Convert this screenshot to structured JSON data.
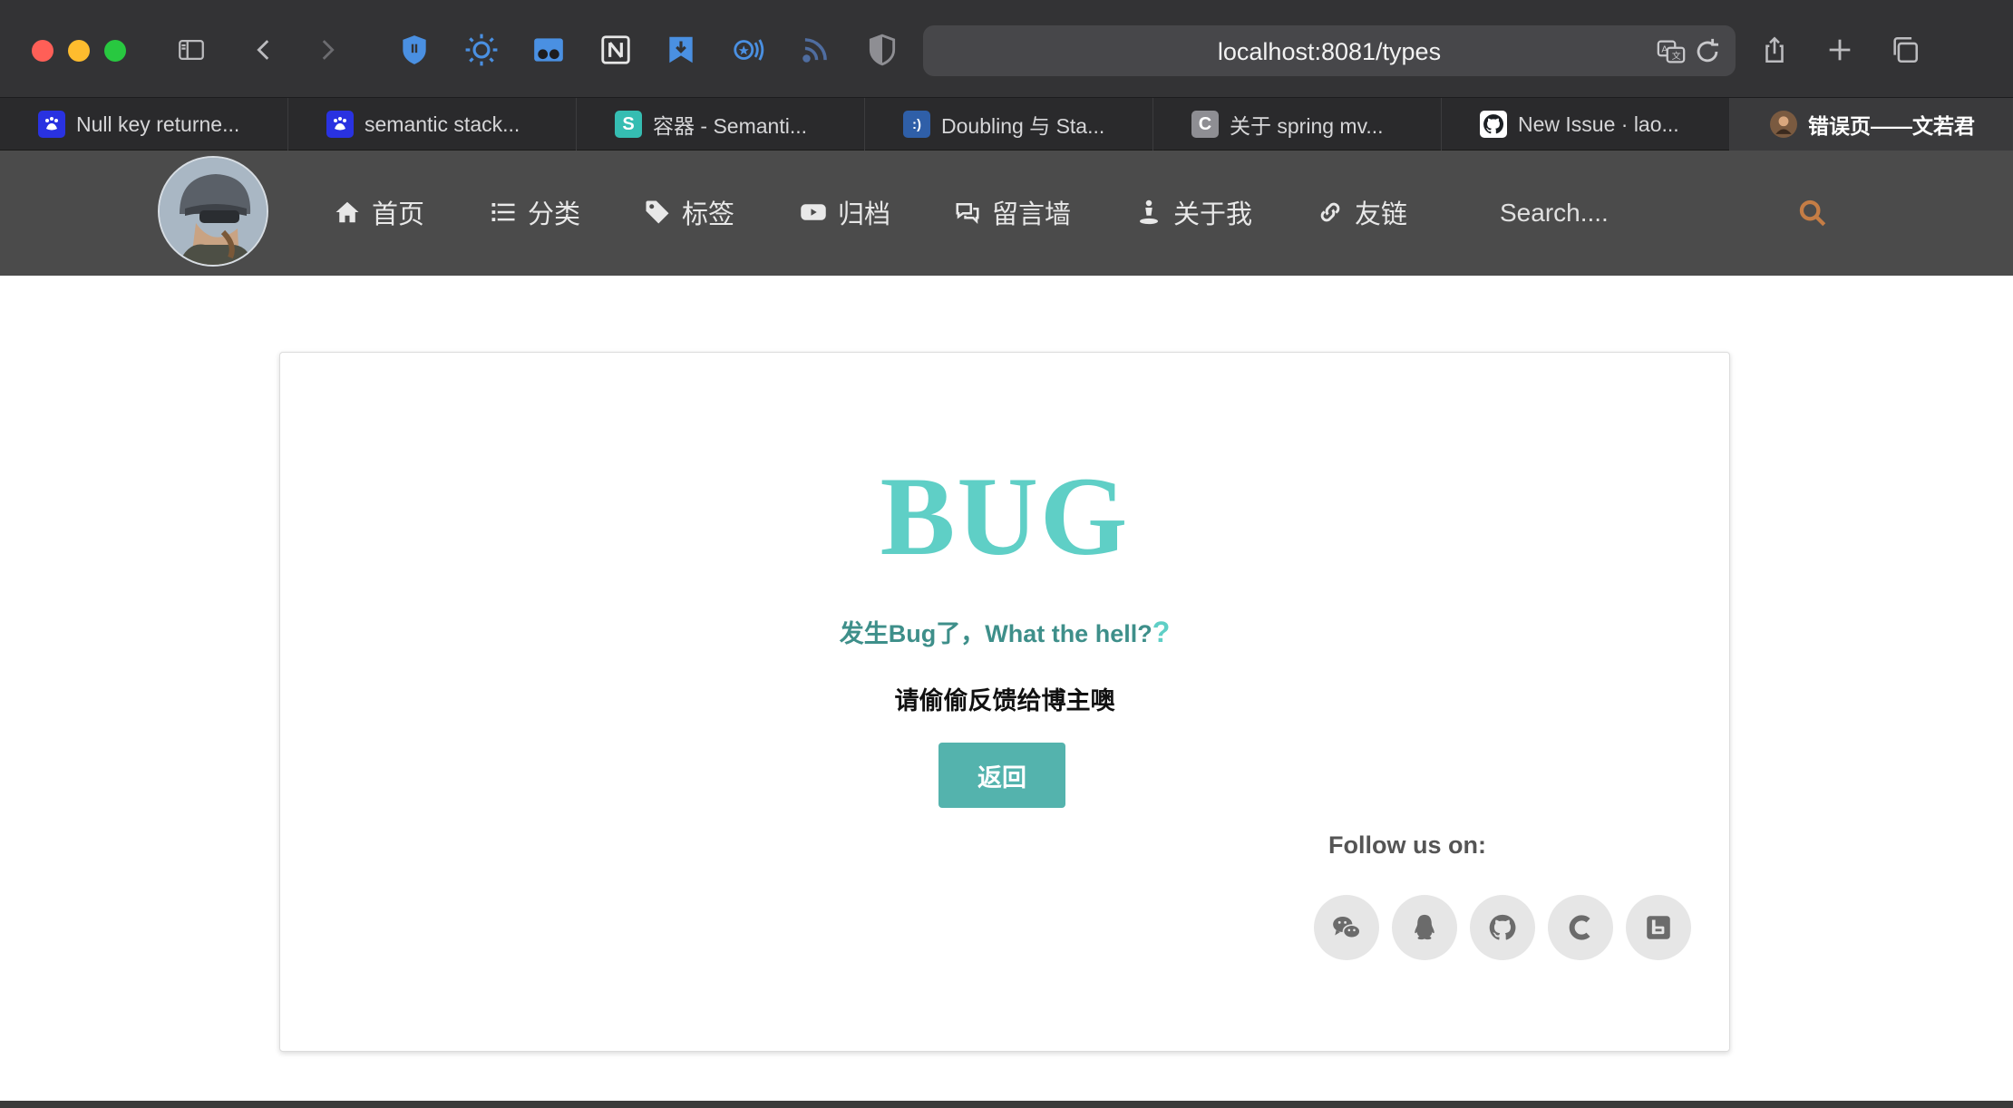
{
  "browser": {
    "url": "localhost:8081/types",
    "tabs": [
      {
        "label": "Null key returne...",
        "icon": "baidu-icon",
        "color": "#2932e1"
      },
      {
        "label": "semantic stack...",
        "icon": "baidu-icon",
        "color": "#2932e1"
      },
      {
        "label": "容器 - Semanti...",
        "icon": "semantic-s-icon",
        "color": "#35bdb2"
      },
      {
        "label": "Doubling 与 Sta...",
        "icon": "doubling-icon",
        "color": "#2f5fa8"
      },
      {
        "label": "关于 spring mv...",
        "icon": "c-icon",
        "color": "#8e8e93"
      },
      {
        "label": "New Issue · lao...",
        "icon": "github-icon",
        "color": "#ffffff"
      },
      {
        "label": "错误页——文若君",
        "icon": "avatar-icon",
        "color": "#7a5a40"
      }
    ]
  },
  "nav": {
    "items": [
      {
        "label": "首页",
        "icon": "home-icon"
      },
      {
        "label": "分类",
        "icon": "list-icon"
      },
      {
        "label": "标签",
        "icon": "tag-icon"
      },
      {
        "label": "归档",
        "icon": "youtube-icon"
      },
      {
        "label": "留言墙",
        "icon": "comments-icon"
      },
      {
        "label": "关于我",
        "icon": "user-icon"
      },
      {
        "label": "友链",
        "icon": "link-icon"
      }
    ],
    "search_placeholder": "Search...."
  },
  "error": {
    "title": "BUG",
    "subtitle": "发生Bug了，What the hell?",
    "subtitle_mark": "?",
    "description": "请偷偷反馈给博主噢",
    "back_label": "返回",
    "follow_label": "Follow us on:"
  },
  "social": [
    "wechat-icon",
    "qq-icon",
    "github-icon",
    "csdn-icon",
    "bilibili-icon"
  ],
  "colors": {
    "accent": "#5fcfc6",
    "button": "#54b3ad",
    "navbar": "#4b4b4b",
    "search_icon": "#c57d45"
  }
}
